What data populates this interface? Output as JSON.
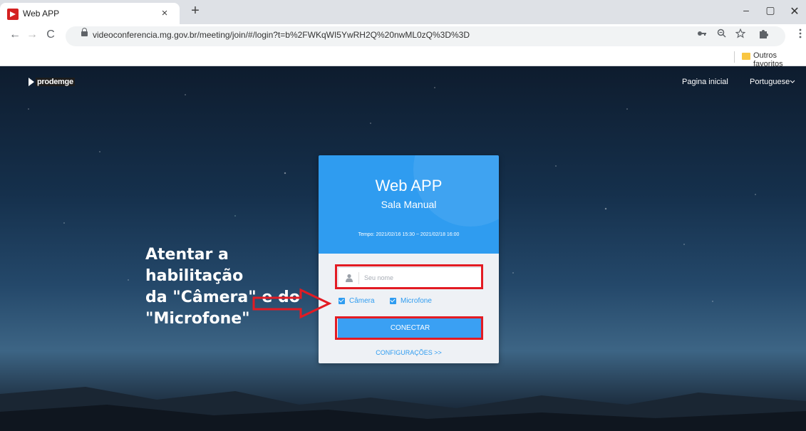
{
  "browser": {
    "tab_title": "Web APP",
    "tab_close": "×",
    "new_tab": "+",
    "window_min": "–",
    "window_max": "▢",
    "window_close": "✕",
    "back": "←",
    "forward": "→",
    "reload": "C",
    "url": "videoconferencia.mg.gov.br/meeting/join/#/login?t=b%2FWKqWI5YwRH2Q%20nwML0zQ%3D%3D",
    "bookmark_folder": "Outros favoritos",
    "icons": [
      "key-icon",
      "zoom-icon",
      "star-icon",
      "puzzle-icon",
      "menu-icon"
    ]
  },
  "header": {
    "logo_text": "prodemge",
    "home_link": "Pagina inicial",
    "language": "Portuguese"
  },
  "card": {
    "app_title": "Web APP",
    "room_name": "Sala Manual",
    "time_range": "Tempo: 2021/02/16 15:30 ~ 2021/02/18 16:00",
    "name_placeholder": "Seu nome",
    "camera_label": "Câmera",
    "microphone_label": "Microfone",
    "camera_checked": true,
    "microphone_checked": true,
    "connect_label": "CONECTAR",
    "settings_link": "CONFIGURAÇÕES >>"
  },
  "annotation": {
    "line1": "Atentar a habilitação",
    "line2": "da \"Câmera\" e do",
    "line3": "\"Microfone\"",
    "highlight_color": "#e31b23"
  },
  "colors": {
    "accent": "#2f9cf0",
    "button": "#3aa0f3"
  }
}
